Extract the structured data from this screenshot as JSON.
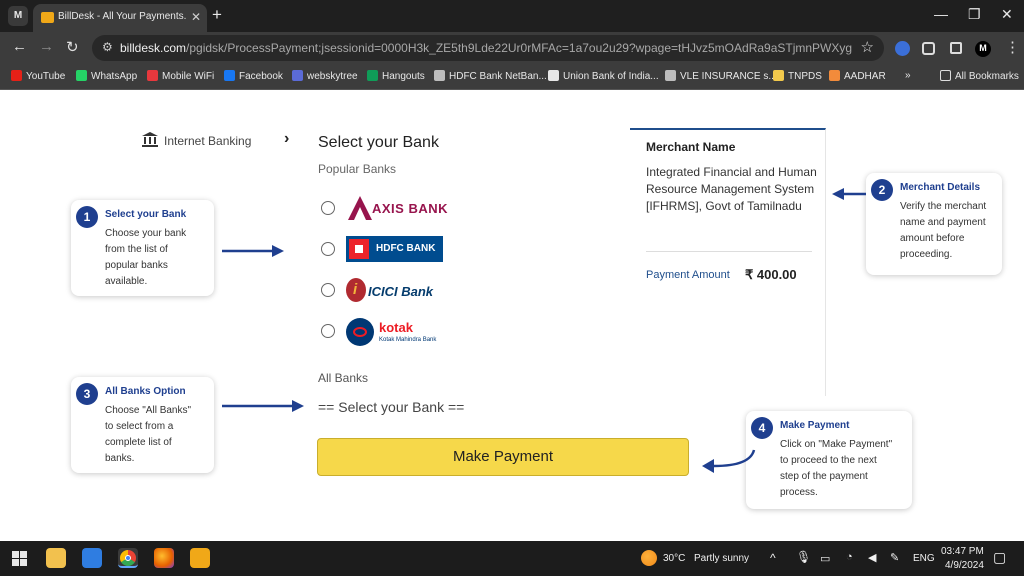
{
  "browser": {
    "tab_title": "BillDesk - All Your Payments. Si",
    "url_domain": "billdesk.com",
    "url_path": "/pgidsk/ProcessPayment;jsessionid=0000H3k_ZE5th9Lde22Ur0rMFAc=1a7ou2u29?wpage=tHJvz5mOAdRa9aSTjmnPWXyg",
    "gmail_letter": "M",
    "profile_letter": "M"
  },
  "bookmarks": [
    {
      "label": "YouTube",
      "color": "#e62117"
    },
    {
      "label": "WhatsApp",
      "color": "#25d366"
    },
    {
      "label": "Mobile WiFi",
      "color": "#e8383d"
    },
    {
      "label": "Facebook",
      "color": "#1877f2"
    },
    {
      "label": "webskytree",
      "color": "#5b6bd8"
    },
    {
      "label": "Hangouts",
      "color": "#0f9d58"
    },
    {
      "label": "HDFC Bank NetBan...",
      "color": "#bdbdbd"
    },
    {
      "label": "Union Bank of India...",
      "color": "#e7e7e7"
    },
    {
      "label": "VLE INSURANCE s...",
      "color": "#bdbdbd"
    },
    {
      "label": "TNPDS",
      "color": "#f2c94c"
    },
    {
      "label": "AADHAR",
      "color": "#f28b3b"
    }
  ],
  "bookmarks_all": "All Bookmarks",
  "page": {
    "internet_banking": "Internet Banking",
    "select_title": "Select your Bank",
    "popular_title": "Popular Banks",
    "banks": [
      {
        "name": "AXIS BANK",
        "logo_mark": "A"
      },
      {
        "name": "HDFC BANK",
        "logo_mark": ""
      },
      {
        "name": "ICICI Bank",
        "logo_mark": "i"
      },
      {
        "name": "kotak",
        "sub": "Kotak Mahindra Bank"
      }
    ],
    "all_banks_label": "All Banks",
    "select_placeholder": "== Select your Bank ==",
    "pay_button": "Make Payment"
  },
  "merchant": {
    "heading": "Merchant Name",
    "name": "Integrated Financial and Human Resource Management System [IFHRMS], Govt of Tamilnadu",
    "amount_label": "Payment Amount",
    "amount": "₹ 400.00"
  },
  "callouts": [
    {
      "num": "1",
      "title": "Select your Bank",
      "body": [
        "Choose your bank",
        "from the list of",
        "popular banks",
        "available."
      ]
    },
    {
      "num": "2",
      "title": "Merchant Details",
      "body": [
        "Verify the merchant",
        "name and payment",
        "amount before",
        "proceeding."
      ]
    },
    {
      "num": "3",
      "title": "All Banks Option",
      "body": [
        "Choose \"All Banks\"",
        "to select from a",
        "complete list of",
        "banks."
      ]
    },
    {
      "num": "4",
      "title": "Make Payment",
      "body": [
        "Click on \"Make Payment\"",
        "to proceed to the next",
        "step of the payment",
        "process."
      ]
    }
  ],
  "taskbar": {
    "temperature": "30°C",
    "weather": "Partly sunny",
    "lang": "ENG",
    "time": "03:47 PM",
    "date": "4/9/2024"
  },
  "colors": {
    "accent": "#1f3f8f",
    "pay_button": "#f6d84a",
    "axis": "#97144d",
    "hdfc": "#004c8f",
    "icici": "#b02a30",
    "kotak": "#ed1c24"
  }
}
